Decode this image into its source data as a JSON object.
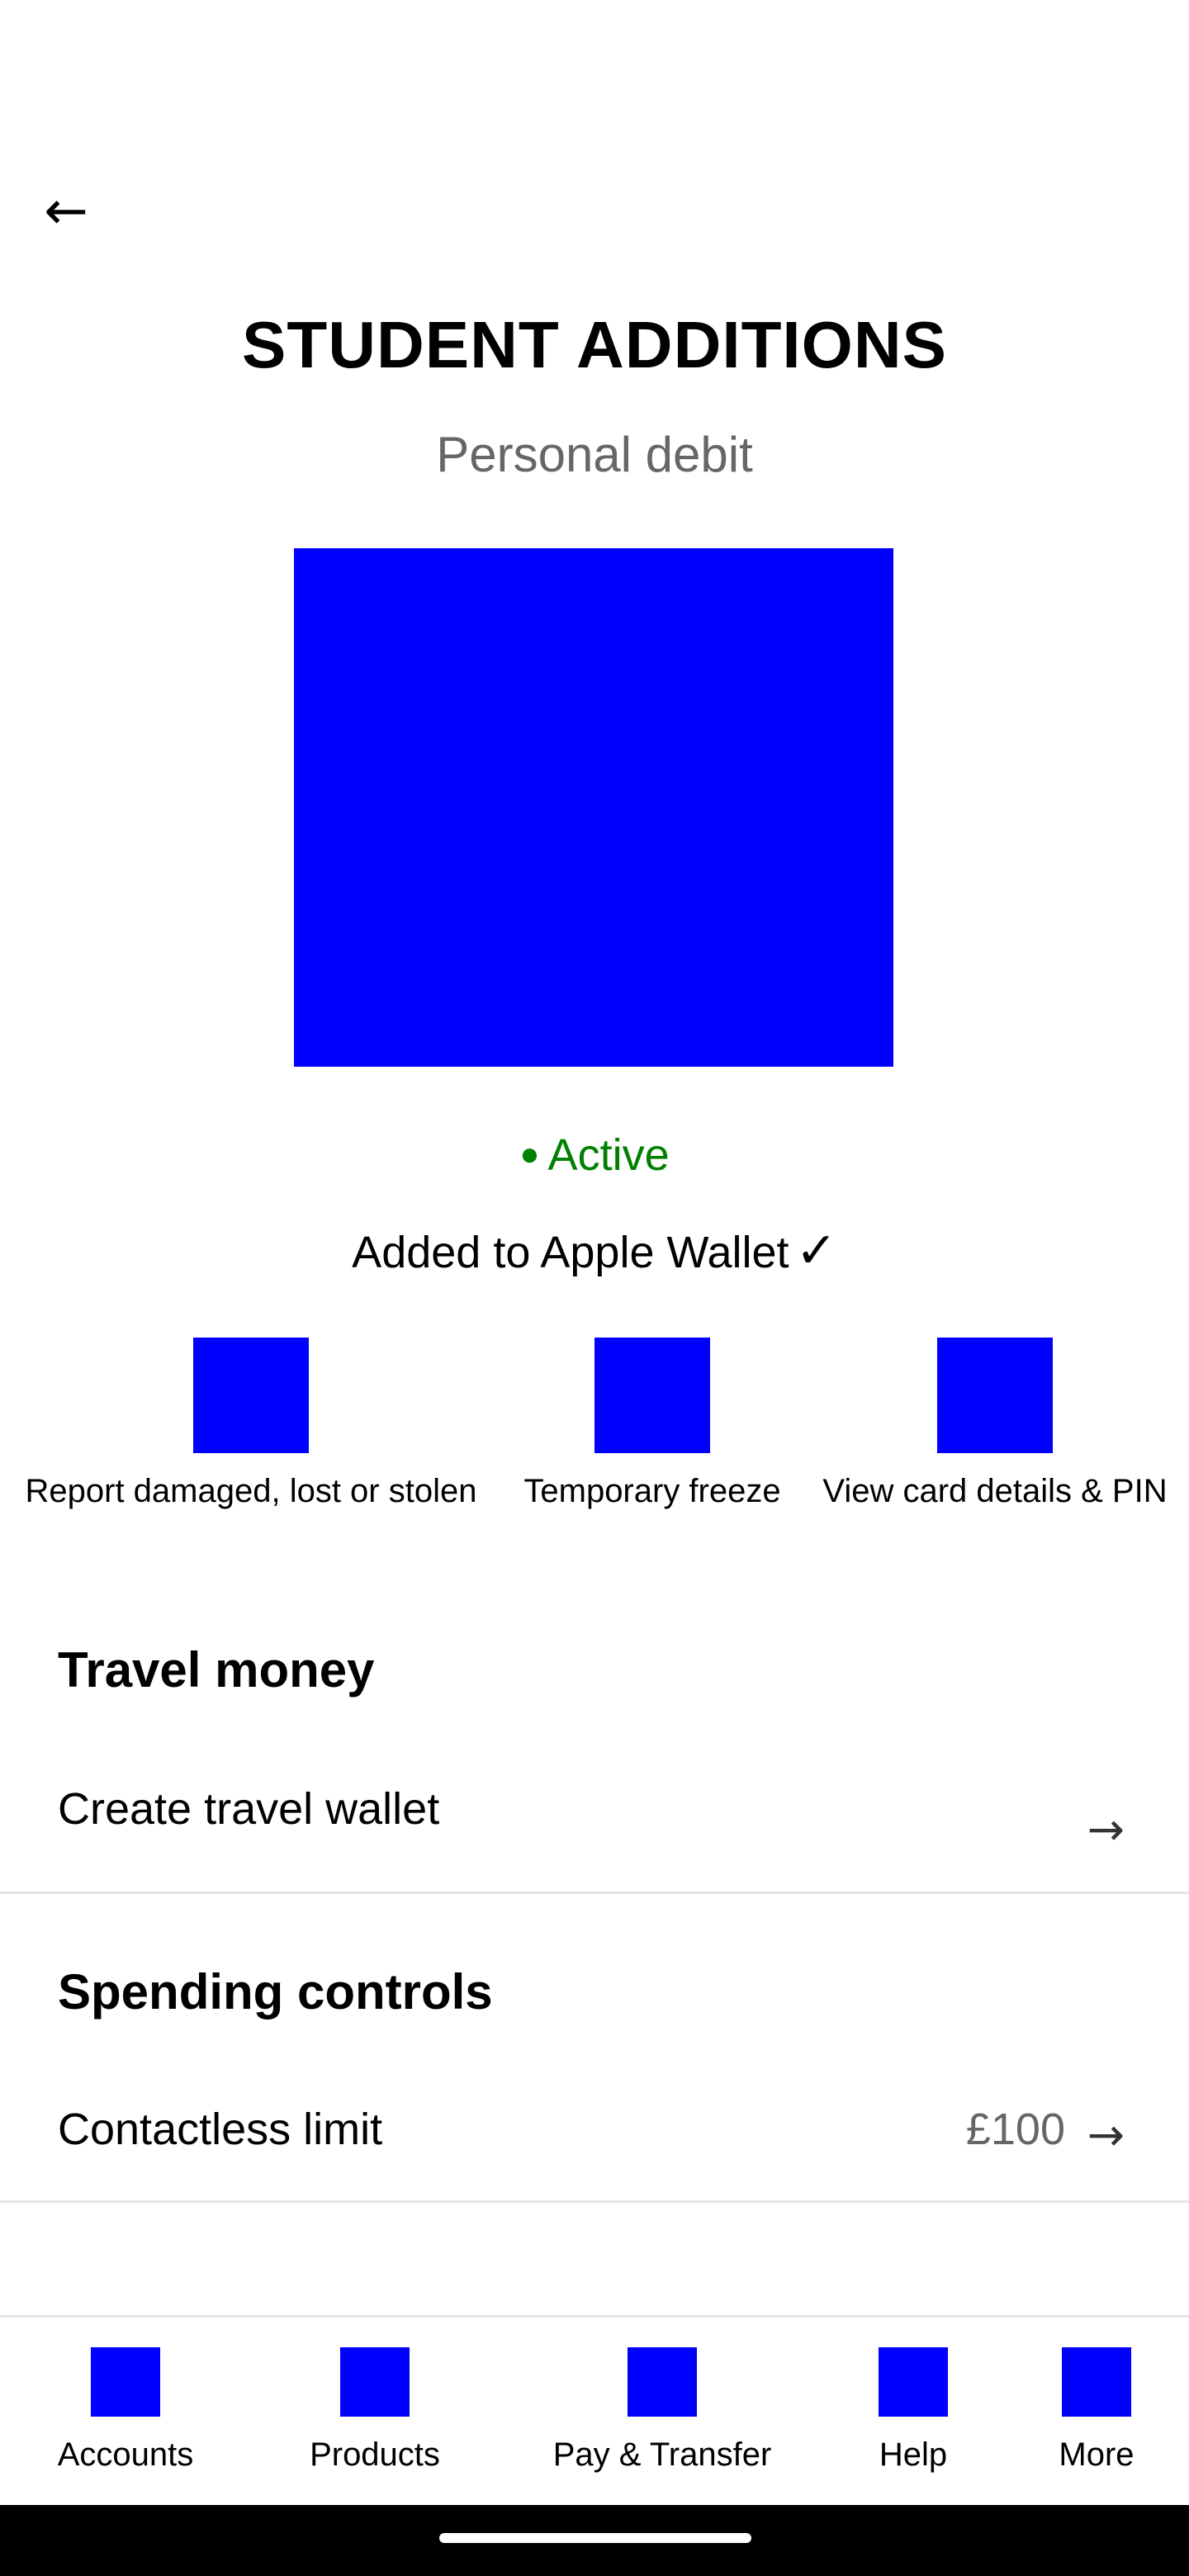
{
  "header": {
    "back_icon": "←",
    "title": "STUDENT ADDITIONS",
    "subtitle": "Personal debit"
  },
  "card": {
    "status_dot": "●",
    "status": "Active",
    "wallet_text": "Added to Apple Wallet",
    "wallet_check": "✓"
  },
  "actions": [
    {
      "label": "Report damaged, lost or stolen"
    },
    {
      "label": "Temporary freeze"
    },
    {
      "label": "View card details & PIN"
    }
  ],
  "travel": {
    "title": "Travel money",
    "create_wallet": "Create travel wallet",
    "arrow": "→"
  },
  "spending": {
    "title": "Spending controls",
    "contactless_label": "Contactless limit",
    "contactless_value": "£100",
    "arrow": "→"
  },
  "tabs": [
    {
      "label": "Accounts"
    },
    {
      "label": "Products"
    },
    {
      "label": "Pay & Transfer"
    },
    {
      "label": "Help"
    },
    {
      "label": "More"
    }
  ],
  "colors": {
    "accent": "#0000ff",
    "active": "#008000",
    "muted": "#666666"
  }
}
